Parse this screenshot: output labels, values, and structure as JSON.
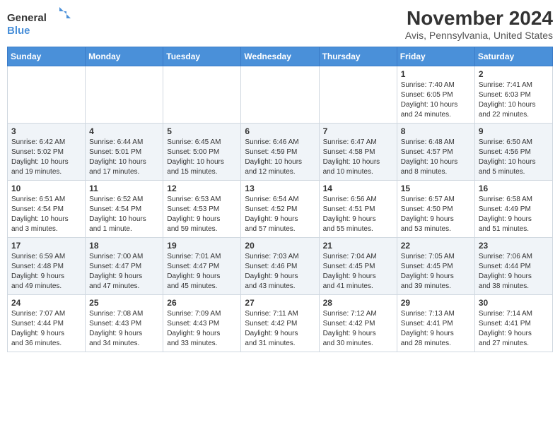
{
  "logo": {
    "line1": "General",
    "line2": "Blue"
  },
  "title": "November 2024",
  "location": "Avis, Pennsylvania, United States",
  "days_of_week": [
    "Sunday",
    "Monday",
    "Tuesday",
    "Wednesday",
    "Thursday",
    "Friday",
    "Saturday"
  ],
  "weeks": [
    [
      {
        "day": "",
        "info": ""
      },
      {
        "day": "",
        "info": ""
      },
      {
        "day": "",
        "info": ""
      },
      {
        "day": "",
        "info": ""
      },
      {
        "day": "",
        "info": ""
      },
      {
        "day": "1",
        "info": "Sunrise: 7:40 AM\nSunset: 6:05 PM\nDaylight: 10 hours\nand 24 minutes."
      },
      {
        "day": "2",
        "info": "Sunrise: 7:41 AM\nSunset: 6:03 PM\nDaylight: 10 hours\nand 22 minutes."
      }
    ],
    [
      {
        "day": "3",
        "info": "Sunrise: 6:42 AM\nSunset: 5:02 PM\nDaylight: 10 hours\nand 19 minutes."
      },
      {
        "day": "4",
        "info": "Sunrise: 6:44 AM\nSunset: 5:01 PM\nDaylight: 10 hours\nand 17 minutes."
      },
      {
        "day": "5",
        "info": "Sunrise: 6:45 AM\nSunset: 5:00 PM\nDaylight: 10 hours\nand 15 minutes."
      },
      {
        "day": "6",
        "info": "Sunrise: 6:46 AM\nSunset: 4:59 PM\nDaylight: 10 hours\nand 12 minutes."
      },
      {
        "day": "7",
        "info": "Sunrise: 6:47 AM\nSunset: 4:58 PM\nDaylight: 10 hours\nand 10 minutes."
      },
      {
        "day": "8",
        "info": "Sunrise: 6:48 AM\nSunset: 4:57 PM\nDaylight: 10 hours\nand 8 minutes."
      },
      {
        "day": "9",
        "info": "Sunrise: 6:50 AM\nSunset: 4:56 PM\nDaylight: 10 hours\nand 5 minutes."
      }
    ],
    [
      {
        "day": "10",
        "info": "Sunrise: 6:51 AM\nSunset: 4:54 PM\nDaylight: 10 hours\nand 3 minutes."
      },
      {
        "day": "11",
        "info": "Sunrise: 6:52 AM\nSunset: 4:54 PM\nDaylight: 10 hours\nand 1 minute."
      },
      {
        "day": "12",
        "info": "Sunrise: 6:53 AM\nSunset: 4:53 PM\nDaylight: 9 hours\nand 59 minutes."
      },
      {
        "day": "13",
        "info": "Sunrise: 6:54 AM\nSunset: 4:52 PM\nDaylight: 9 hours\nand 57 minutes."
      },
      {
        "day": "14",
        "info": "Sunrise: 6:56 AM\nSunset: 4:51 PM\nDaylight: 9 hours\nand 55 minutes."
      },
      {
        "day": "15",
        "info": "Sunrise: 6:57 AM\nSunset: 4:50 PM\nDaylight: 9 hours\nand 53 minutes."
      },
      {
        "day": "16",
        "info": "Sunrise: 6:58 AM\nSunset: 4:49 PM\nDaylight: 9 hours\nand 51 minutes."
      }
    ],
    [
      {
        "day": "17",
        "info": "Sunrise: 6:59 AM\nSunset: 4:48 PM\nDaylight: 9 hours\nand 49 minutes."
      },
      {
        "day": "18",
        "info": "Sunrise: 7:00 AM\nSunset: 4:47 PM\nDaylight: 9 hours\nand 47 minutes."
      },
      {
        "day": "19",
        "info": "Sunrise: 7:01 AM\nSunset: 4:47 PM\nDaylight: 9 hours\nand 45 minutes."
      },
      {
        "day": "20",
        "info": "Sunrise: 7:03 AM\nSunset: 4:46 PM\nDaylight: 9 hours\nand 43 minutes."
      },
      {
        "day": "21",
        "info": "Sunrise: 7:04 AM\nSunset: 4:45 PM\nDaylight: 9 hours\nand 41 minutes."
      },
      {
        "day": "22",
        "info": "Sunrise: 7:05 AM\nSunset: 4:45 PM\nDaylight: 9 hours\nand 39 minutes."
      },
      {
        "day": "23",
        "info": "Sunrise: 7:06 AM\nSunset: 4:44 PM\nDaylight: 9 hours\nand 38 minutes."
      }
    ],
    [
      {
        "day": "24",
        "info": "Sunrise: 7:07 AM\nSunset: 4:44 PM\nDaylight: 9 hours\nand 36 minutes."
      },
      {
        "day": "25",
        "info": "Sunrise: 7:08 AM\nSunset: 4:43 PM\nDaylight: 9 hours\nand 34 minutes."
      },
      {
        "day": "26",
        "info": "Sunrise: 7:09 AM\nSunset: 4:43 PM\nDaylight: 9 hours\nand 33 minutes."
      },
      {
        "day": "27",
        "info": "Sunrise: 7:11 AM\nSunset: 4:42 PM\nDaylight: 9 hours\nand 31 minutes."
      },
      {
        "day": "28",
        "info": "Sunrise: 7:12 AM\nSunset: 4:42 PM\nDaylight: 9 hours\nand 30 minutes."
      },
      {
        "day": "29",
        "info": "Sunrise: 7:13 AM\nSunset: 4:41 PM\nDaylight: 9 hours\nand 28 minutes."
      },
      {
        "day": "30",
        "info": "Sunrise: 7:14 AM\nSunset: 4:41 PM\nDaylight: 9 hours\nand 27 minutes."
      }
    ]
  ]
}
